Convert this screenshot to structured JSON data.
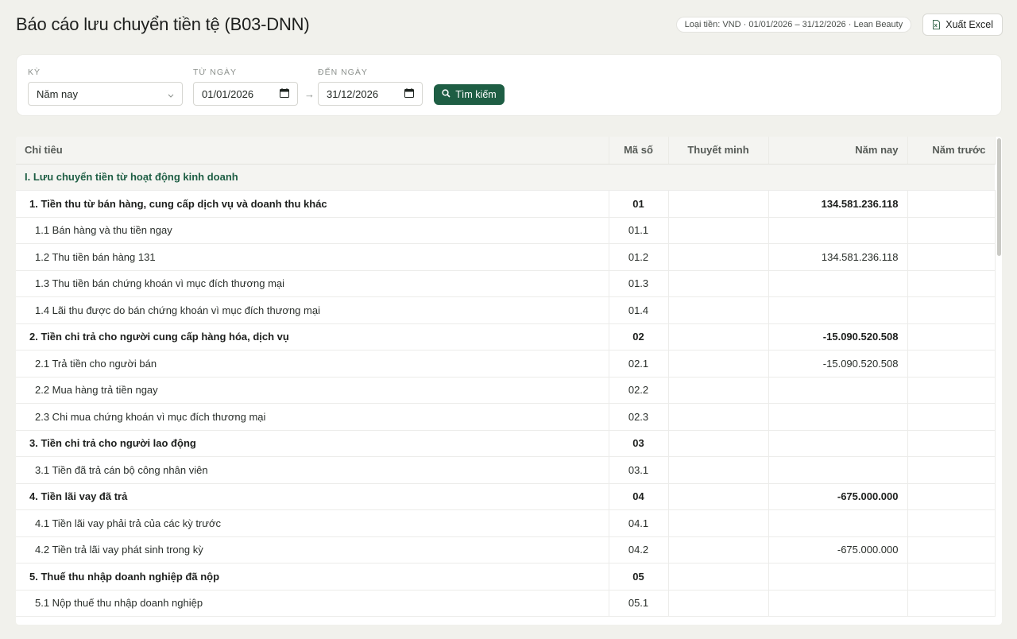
{
  "header": {
    "title": "Báo cáo lưu chuyển tiền tệ (B03-DNN)",
    "context": "Loại tiền: VND · 01/01/2026 – 31/12/2026 · Lean Beauty",
    "export_label": "Xuất Excel"
  },
  "filters": {
    "period_label": "Kỳ",
    "period_value": "Năm nay",
    "from_label": "Từ ngày",
    "from_value": "01/01/2026",
    "to_label": "Đến ngày",
    "to_value": "31/12/2026",
    "search_label": "Tìm kiếm"
  },
  "table": {
    "columns": [
      "Chỉ tiêu",
      "Mã số",
      "Thuyết minh",
      "Năm nay",
      "Năm trước"
    ],
    "section": "I. Lưu chuyển tiền từ hoạt động kinh doanh",
    "rows": [
      {
        "name": "1. Tiền thu từ bán hàng, cung cấp dịch vụ và doanh thu khác",
        "code": "01",
        "note": "",
        "current": "134.581.236.118",
        "previous": ""
      },
      {
        "name": "1.1 Bán hàng và thu tiền ngay",
        "code": "01.1",
        "note": "",
        "current": "",
        "previous": ""
      },
      {
        "name": "1.2 Thu tiền bán hàng 131",
        "code": "01.2",
        "note": "",
        "current": "134.581.236.118",
        "previous": ""
      },
      {
        "name": "1.3 Thu tiền bán chứng khoán vì mục đích thương mại",
        "code": "01.3",
        "note": "",
        "current": "",
        "previous": ""
      },
      {
        "name": "1.4 Lãi thu được do bán chứng khoán vì mục đích thương mại",
        "code": "01.4",
        "note": "",
        "current": "",
        "previous": ""
      },
      {
        "name": "2. Tiền chi trả cho người cung cấp hàng hóa, dịch vụ",
        "code": "02",
        "note": "",
        "current": "-15.090.520.508",
        "previous": ""
      },
      {
        "name": "2.1 Trả tiền cho người bán",
        "code": "02.1",
        "note": "",
        "current": "-15.090.520.508",
        "previous": ""
      },
      {
        "name": "2.2 Mua hàng trả tiền ngay",
        "code": "02.2",
        "note": "",
        "current": "",
        "previous": ""
      },
      {
        "name": "2.3 Chi mua chứng khoán vì mục đích thương mại",
        "code": "02.3",
        "note": "",
        "current": "",
        "previous": ""
      },
      {
        "name": "3. Tiền chi trả cho người lao động",
        "code": "03",
        "note": "",
        "current": "",
        "previous": ""
      },
      {
        "name": "3.1 Tiền đã trả cán bộ công nhân viên",
        "code": "03.1",
        "note": "",
        "current": "",
        "previous": ""
      },
      {
        "name": "4. Tiền lãi vay đã trả",
        "code": "04",
        "note": "",
        "current": "-675.000.000",
        "previous": ""
      },
      {
        "name": "4.1 Tiền lãi vay phải trả của các kỳ trước",
        "code": "04.1",
        "note": "",
        "current": "",
        "previous": ""
      },
      {
        "name": "4.2 Tiền trả lãi vay phát sinh trong kỳ",
        "code": "04.2",
        "note": "",
        "current": "-675.000.000",
        "previous": ""
      },
      {
        "name": "5. Thuế thu nhập doanh nghiệp đã nộp",
        "code": "05",
        "note": "",
        "current": "",
        "previous": ""
      },
      {
        "name": "5.1 Nộp thuế thu nhập doanh nghiệp",
        "code": "05.1",
        "note": "",
        "current": "",
        "previous": ""
      }
    ]
  },
  "colors": {
    "accent": "#1e5e44",
    "background": "#f1f1ec"
  }
}
